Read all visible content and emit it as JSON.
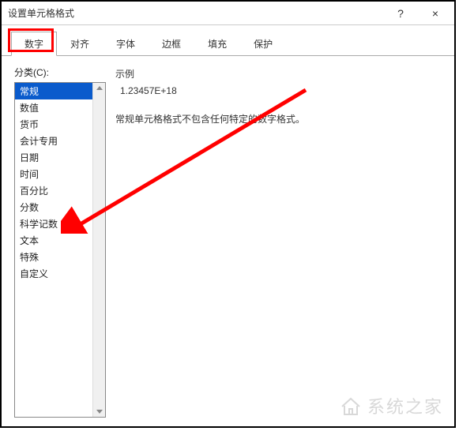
{
  "window": {
    "title": "设置单元格格式",
    "help": "?",
    "close": "×"
  },
  "tabs": [
    {
      "label": "数字",
      "active": true
    },
    {
      "label": "对齐",
      "active": false
    },
    {
      "label": "字体",
      "active": false
    },
    {
      "label": "边框",
      "active": false
    },
    {
      "label": "填充",
      "active": false
    },
    {
      "label": "保护",
      "active": false
    }
  ],
  "category_label": "分类(C):",
  "categories": [
    {
      "label": "常规",
      "selected": true
    },
    {
      "label": "数值",
      "selected": false
    },
    {
      "label": "货币",
      "selected": false
    },
    {
      "label": "会计专用",
      "selected": false
    },
    {
      "label": "日期",
      "selected": false
    },
    {
      "label": "时间",
      "selected": false
    },
    {
      "label": "百分比",
      "selected": false
    },
    {
      "label": "分数",
      "selected": false
    },
    {
      "label": "科学记数",
      "selected": false
    },
    {
      "label": "文本",
      "selected": false
    },
    {
      "label": "特殊",
      "selected": false
    },
    {
      "label": "自定义",
      "selected": false
    }
  ],
  "right": {
    "example_label": "示例",
    "example_value": "1.23457E+18",
    "description": "常规单元格格式不包含任何特定的数字格式。"
  },
  "annotation": {
    "arrow_color": "#ff0000"
  },
  "watermark": {
    "text": "系统之家",
    "icon": "house-icon"
  }
}
